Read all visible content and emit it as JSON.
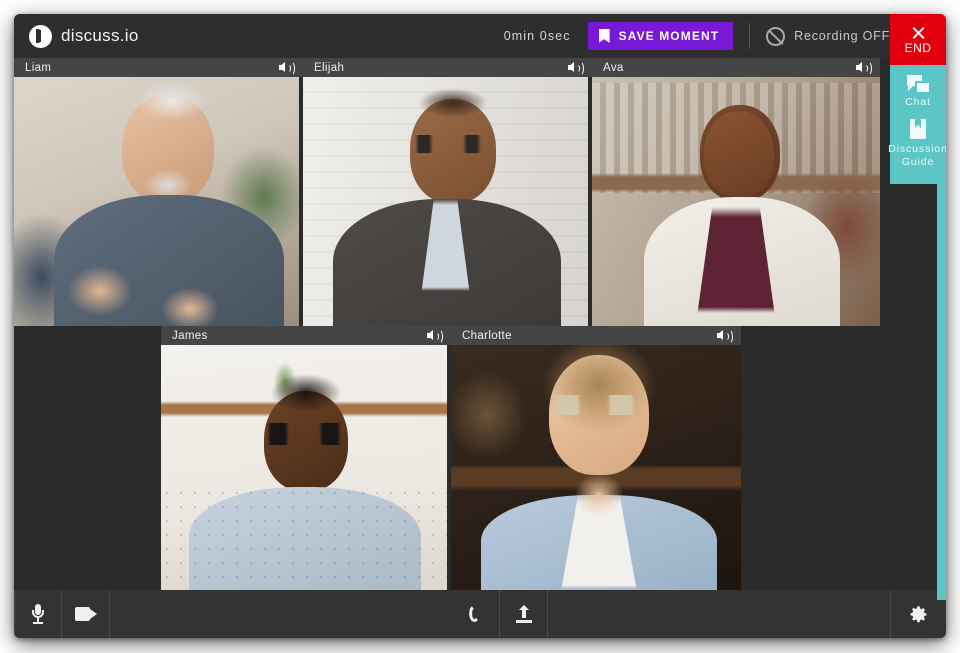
{
  "app": {
    "brand": "discuss.io",
    "brand_logo_icon": "discussio-d-logo-icon"
  },
  "topbar": {
    "timer": "0min 0sec",
    "save_moment_label": "SAVE MOMENT",
    "save_moment_icon": "bookmark-icon",
    "save_moment_color": "#7719d6",
    "recording_label": "Recording OFF",
    "recording_icon": "recording-off-icon",
    "end_label": "END",
    "end_icon": "close-x-icon",
    "end_color": "#e2000f"
  },
  "sidebar": {
    "accent_color": "#5cc6c6",
    "items": [
      {
        "label": "Chat",
        "icon": "chat-bubbles-icon"
      },
      {
        "label": "Discussion\nGuide",
        "label_line1": "Discussion",
        "label_line2": "Guide",
        "icon": "guide-bookmark-icon"
      }
    ]
  },
  "stage": {
    "speaker_icon": "speaker-volume-icon",
    "rows": [
      {
        "participants": [
          {
            "name": "Liam",
            "scene": "older-man-grey-beard-blue-shirt"
          },
          {
            "name": "Elijah",
            "scene": "man-glasses-grey-blazer"
          },
          {
            "name": "Ava",
            "scene": "woman-curly-hair-white-blazer"
          }
        ]
      },
      {
        "participants": [
          {
            "name": "James",
            "scene": "man-glasses-patterned-shirt"
          },
          {
            "name": "Charlotte",
            "scene": "woman-glasses-blue-shirt"
          }
        ]
      }
    ]
  },
  "bottombar": {
    "controls": [
      {
        "name": "microphone",
        "icon": "microphone-icon"
      },
      {
        "name": "camera",
        "icon": "video-camera-icon"
      },
      {
        "name": "dial",
        "icon": "phone-icon"
      },
      {
        "name": "upload",
        "icon": "upload-icon"
      },
      {
        "name": "settings",
        "icon": "gear-icon"
      }
    ]
  }
}
